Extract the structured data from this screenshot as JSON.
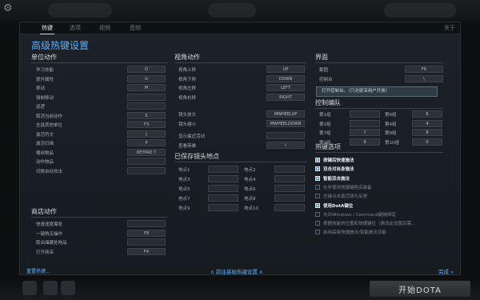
{
  "tabs": [
    "热键",
    "选项",
    "视频",
    "音频"
  ],
  "close_label": "关于",
  "title": "高级热键设置",
  "unit": {
    "heading": "单位动作",
    "rows": [
      {
        "label": "学习技能",
        "key": "O"
      },
      {
        "label": "提升属性",
        "key": "U"
      },
      {
        "label": "移动",
        "key": "M"
      },
      {
        "label": "强制移动",
        "key": ""
      },
      {
        "label": "巡逻",
        "key": ""
      },
      {
        "label": "取消当前动作",
        "key": "S"
      },
      {
        "label": "全选其他单位",
        "key": "F3"
      },
      {
        "label": "激活符文",
        "key": "J"
      },
      {
        "label": "激活扫描",
        "key": "P"
      },
      {
        "label": "嘲讽物品",
        "key": "KEYPAD 7"
      },
      {
        "label": "动作物品",
        "key": ""
      },
      {
        "label": "切换自动攻击",
        "key": ""
      }
    ]
  },
  "shop": {
    "heading": "商店动作",
    "rows": [
      {
        "label": "快速速度爆发",
        "key": ""
      },
      {
        "label": "一键购买操作",
        "key": "F8"
      },
      {
        "label": "取出储藏处物品",
        "key": ""
      },
      {
        "label": "打开商店",
        "key": "F4"
      }
    ]
  },
  "camera": {
    "heading": "视角动作",
    "rows": [
      {
        "label": "视角上移",
        "key": "UP"
      },
      {
        "label": "视角下移",
        "key": "DOWN"
      },
      {
        "label": "视角左移",
        "key": "LEFT"
      },
      {
        "label": "视角右移",
        "key": "RIGHT"
      },
      {
        "label": "镜头放大",
        "key": "MWHEELUP"
      },
      {
        "label": "镜头缩小",
        "key": "MWHEELDOWN"
      },
      {
        "label": "显示最近活动",
        "key": ""
      },
      {
        "label": "查看英雄",
        "key": "I"
      }
    ]
  },
  "saved": {
    "heading": "已保存镜头地点",
    "left": [
      "地点1",
      "地点3",
      "地点5",
      "地点7",
      "地点9"
    ],
    "right": [
      "地点2",
      "地点4",
      "地点6",
      "地点8",
      "地点10"
    ]
  },
  "ui": {
    "heading": "界面",
    "rows": [
      {
        "label": "截图",
        "key": "F6"
      },
      {
        "label": "控制台",
        "key": "\\"
      }
    ],
    "tooltip": "打开控制台。（只对原深用户开放）"
  },
  "control": {
    "heading": "控制编队",
    "rows": [
      {
        "l_label": "第1组",
        "l_key": "",
        "r_label": "第6组",
        "r_key": "6"
      },
      {
        "l_label": "第2组",
        "l_key": "",
        "r_label": "第4组",
        "r_key": "4"
      },
      {
        "l_label": "第7组",
        "l_key": "7",
        "r_label": "第8组",
        "r_key": "8"
      },
      {
        "l_label": "第9组",
        "l_key": "9",
        "r_label": "第10组",
        "r_key": "0"
      }
    ]
  },
  "hotkey_options": {
    "heading": "热键选项",
    "items": [
      {
        "label": "按键后快速施法",
        "checked": true
      },
      {
        "label": "双击对自身施法",
        "checked": true
      },
      {
        "label": "智能双击施法",
        "checked": true
      },
      {
        "label": "在非使用快捷键购买装备",
        "checked": false
      },
      {
        "label": "左键点击激活镜头反馈",
        "checked": false
      },
      {
        "label": "使用DotA键位",
        "checked": true
      },
      {
        "label": "允许Windows / Command键被绑定",
        "checked": false
      },
      {
        "label": "根据技能的位置和快捷键位（更改此设置后需...",
        "checked": false
      },
      {
        "label": "启用高级快捷施法/智能施法功能",
        "checked": false
      }
    ]
  },
  "footer": {
    "left": "重置热键...",
    "center": "前往基础热键设置",
    "right": "完成"
  },
  "play_button": "开始DOTA",
  "colors": {
    "accent": "#5fb0ff",
    "panel": "#1c2228"
  }
}
